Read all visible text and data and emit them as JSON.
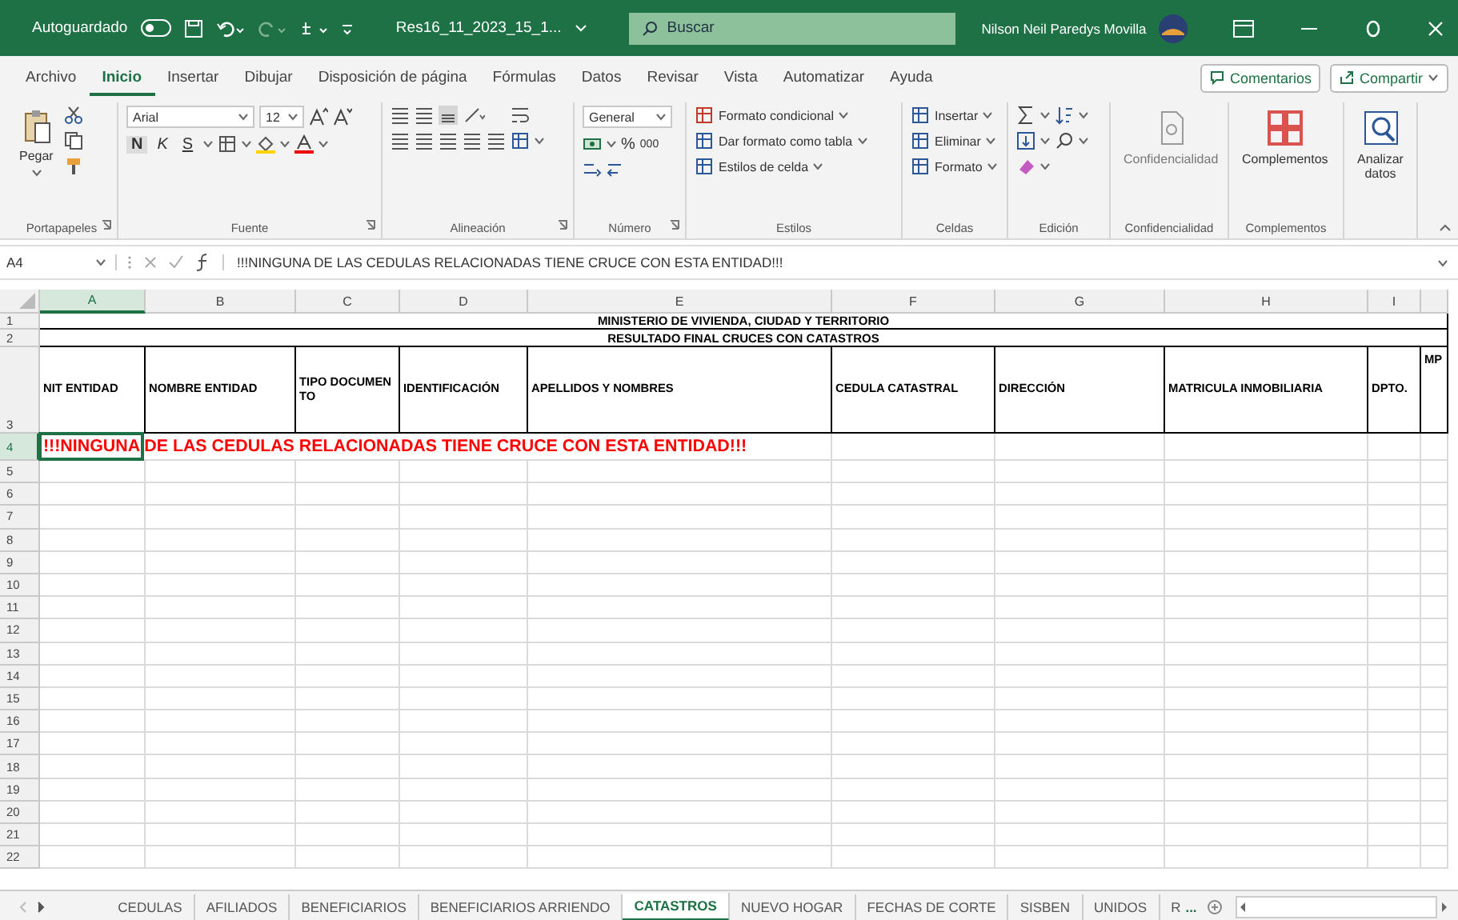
{
  "title_bar": {
    "autosave_label": "Autoguardado",
    "autosave_on": false,
    "filename": "Res16_11_2023_15_1...",
    "search": {
      "placeholder": "Buscar"
    },
    "user": "Nilson Neil Paredys Movilla"
  },
  "menu": {
    "tabs": [
      {
        "label": "Archivo",
        "selected": false
      },
      {
        "label": "Inicio",
        "selected": true
      },
      {
        "label": "Insertar",
        "selected": false
      },
      {
        "label": "Dibujar",
        "selected": false
      },
      {
        "label": "Disposición de página",
        "selected": false
      },
      {
        "label": "Fórmulas",
        "selected": false
      },
      {
        "label": "Datos",
        "selected": false
      },
      {
        "label": "Revisar",
        "selected": false
      },
      {
        "label": "Vista",
        "selected": false
      },
      {
        "label": "Automatizar",
        "selected": false
      },
      {
        "label": "Ayuda",
        "selected": false
      }
    ],
    "buttons": [
      "Comentarios",
      "Compartir"
    ]
  },
  "ribbon": {
    "groups": [
      {
        "kind": "clipboard",
        "label": "Portapapeles",
        "launcher": true,
        "button": "Pegar"
      },
      {
        "kind": "font",
        "label": "Fuente",
        "launcher": true,
        "font": "Arial",
        "size": "12",
        "styles": [
          "N",
          "K",
          "S"
        ]
      },
      {
        "kind": "alignment",
        "label": "Alineación",
        "launcher": true
      },
      {
        "kind": "number",
        "label": "Número",
        "launcher": true,
        "format": "General",
        "symbols": [
          "%",
          "000"
        ]
      },
      {
        "kind": "list",
        "label": "Estilos",
        "items": [
          "Formato condicional",
          "Dar formato como tabla",
          "Estilos de celda"
        ]
      },
      {
        "kind": "list",
        "label": "Celdas",
        "items": [
          "Insertar",
          "Eliminar",
          "Formato"
        ]
      },
      {
        "kind": "editing",
        "label": "Edición"
      },
      {
        "kind": "large",
        "label": "Confidencialidad",
        "button": {
          "text": "Confidencialidad",
          "disabled": true
        }
      },
      {
        "kind": "large",
        "label": "Complementos",
        "button": {
          "text": "Complementos",
          "disabled": false
        }
      },
      {
        "kind": "large",
        "button": {
          "text": "Analizar datos",
          "disabled": false
        }
      }
    ]
  },
  "formula_bar": {
    "name_box": "A4",
    "formula": "!!!NINGUNA DE LAS CEDULAS RELACIONADAS TIENE CRUCE CON ESTA ENTIDAD!!!"
  },
  "sheet": {
    "columns": [
      {
        "label": "A",
        "selected": true
      },
      {
        "label": "B",
        "selected": false
      },
      {
        "label": "C",
        "selected": false
      },
      {
        "label": "D",
        "selected": false
      },
      {
        "label": "E",
        "selected": false
      },
      {
        "label": "F",
        "selected": false
      },
      {
        "label": "G",
        "selected": false
      },
      {
        "label": "H",
        "selected": false
      },
      {
        "label": "I",
        "selected": false
      }
    ],
    "title_rows": [
      {
        "row": "1",
        "text": "MINISTERIO DE VIVIENDA, CIUDAD Y TERRITORIO"
      },
      {
        "row": "2",
        "text": "RESULTADO FINAL CRUCES CON CATASTROS"
      }
    ],
    "header_row": {
      "row": "3",
      "cells": [
        "NIT ENTIDAD",
        "NOMBRE ENTIDAD",
        "TIPO DOCUMENTO",
        "IDENTIFICACIÓN",
        "APELLIDOS Y NOMBRES",
        "CEDULA CATASTRAL",
        "DIRECCIÓN",
        "MATRICULA INMOBILIARIA",
        "DPTO.",
        "MP"
      ]
    },
    "message_row": {
      "row": "4",
      "text": "!!!NINGUNA DE LAS CEDULAS RELACIONADAS TIENE CRUCE CON ESTA ENTIDAD!!!",
      "selected": true
    },
    "empty_rows": [
      "5",
      "6",
      "7",
      "8",
      "9",
      "10",
      "11",
      "12",
      "13",
      "14",
      "15",
      "16",
      "17",
      "18",
      "19",
      "20",
      "21",
      "22"
    ]
  },
  "sheet_tabs": {
    "tabs": [
      {
        "label": "CEDULAS",
        "selected": false
      },
      {
        "label": "AFILIADOS",
        "selected": false
      },
      {
        "label": "BENEFICIARIOS",
        "selected": false
      },
      {
        "label": "BENEFICIARIOS ARRIENDO",
        "selected": false
      },
      {
        "label": "CATASTROS",
        "selected": true
      },
      {
        "label": "NUEVO HOGAR",
        "selected": false
      },
      {
        "label": "FECHAS DE CORTE",
        "selected": false
      },
      {
        "label": "SISBEN",
        "selected": false
      },
      {
        "label": "UNIDOS",
        "selected": false
      },
      {
        "label": "R",
        "selected": false
      }
    ],
    "more": "..."
  }
}
